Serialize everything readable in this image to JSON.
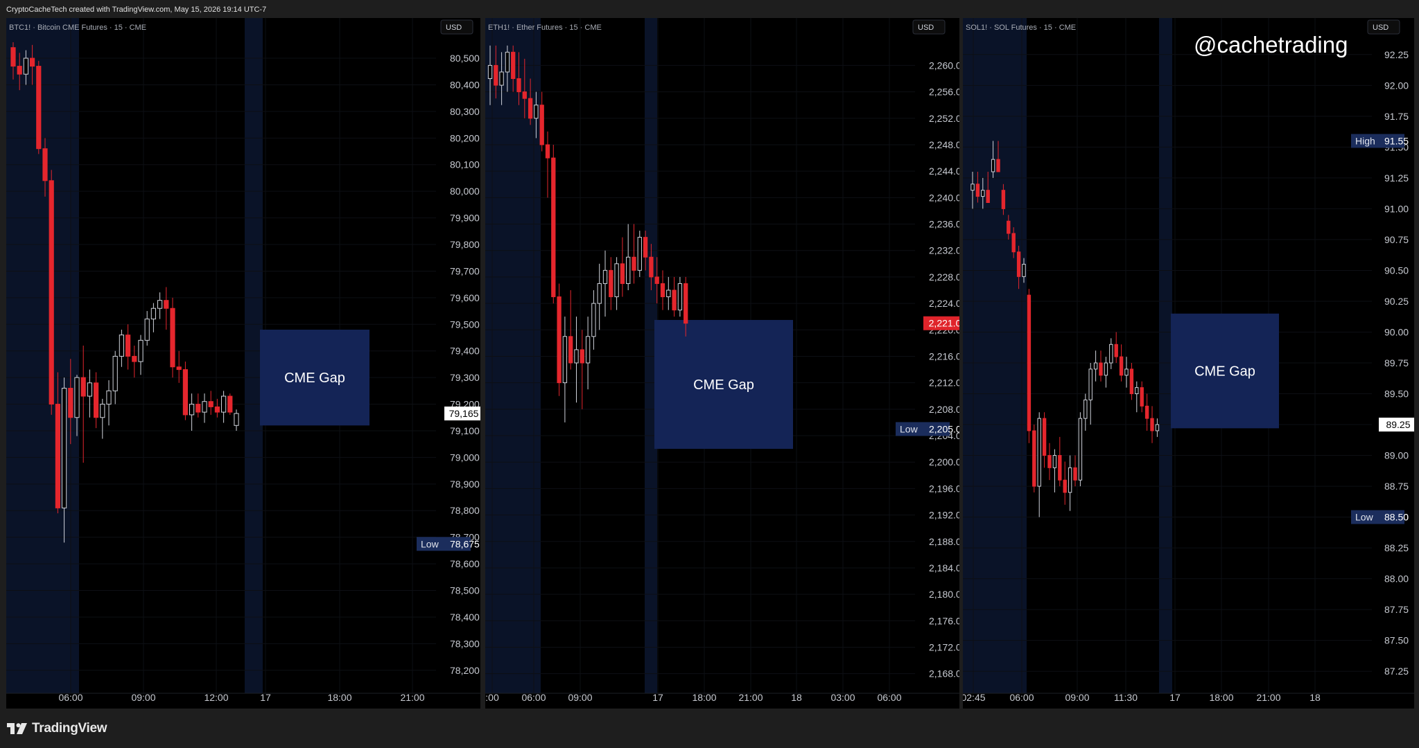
{
  "header": {
    "attribution": "CryptoCacheTech created with TradingView.com, May 15, 2026 19:14 UTC-7"
  },
  "watermark": "@cachetrading",
  "footer": {
    "brand": "TradingView"
  },
  "colors": {
    "up": "#d1d4dc",
    "down": "#e5262d",
    "gap_box": "#142456",
    "session_shade": "#0a1328",
    "label_bg": "#1b2d5c",
    "last_price_white": "#ffffff",
    "last_price_red": "#e0242b"
  },
  "chart_data": [
    {
      "type": "candlestick",
      "symbol_label": "BTC1! · Bitcoin CME Futures · 15 · CME",
      "currency": "USD",
      "ylim": [
        78150,
        80560
      ],
      "y_ticks": [
        78200,
        78300,
        78400,
        78500,
        78600,
        78700,
        78800,
        78900,
        79000,
        79100,
        79200,
        79300,
        79400,
        79500,
        79600,
        79700,
        79800,
        79900,
        80000,
        80100,
        80200,
        80300,
        80400,
        80500
      ],
      "y_tick_labels": [
        "78,200",
        "78,300",
        "78,400",
        "78,500",
        "78,600",
        "78,700",
        "78,800",
        "78,900",
        "79,000",
        "79,100",
        "79,200",
        "79,300",
        "79,400",
        "79,500",
        "79,600",
        "79,700",
        "79,800",
        "79,900",
        "80,000",
        "80,100",
        "80,200",
        "80,300",
        "80,400",
        "80,500"
      ],
      "x_ticks": [
        "06:00",
        "09:00",
        "12:00",
        "17",
        "18:00",
        "21:00"
      ],
      "last_price": {
        "value": 79165,
        "label": "79,165",
        "style": "white"
      },
      "low_marker": {
        "tag": "Low",
        "value": 78675,
        "label": "78,675"
      },
      "gap": {
        "label": "CME Gap",
        "from": 79120,
        "to": 79480
      },
      "candles": [
        {
          "o": 80540,
          "h": 80560,
          "l": 80420,
          "c": 80470
        },
        {
          "o": 80470,
          "h": 80520,
          "l": 80380,
          "c": 80440
        },
        {
          "o": 80440,
          "h": 80530,
          "l": 80400,
          "c": 80500
        },
        {
          "o": 80500,
          "h": 80550,
          "l": 80400,
          "c": 80470
        },
        {
          "o": 80470,
          "h": 80490,
          "l": 80140,
          "c": 80160
        },
        {
          "o": 80160,
          "h": 80200,
          "l": 79980,
          "c": 80040
        },
        {
          "o": 80040,
          "h": 80080,
          "l": 79160,
          "c": 79200
        },
        {
          "o": 79200,
          "h": 79320,
          "l": 78790,
          "c": 78810
        },
        {
          "o": 78810,
          "h": 79300,
          "l": 78680,
          "c": 79260
        },
        {
          "o": 79260,
          "h": 79370,
          "l": 79050,
          "c": 79150
        },
        {
          "o": 79150,
          "h": 79310,
          "l": 79080,
          "c": 79300
        },
        {
          "o": 79300,
          "h": 79420,
          "l": 78980,
          "c": 79230
        },
        {
          "o": 79230,
          "h": 79330,
          "l": 79150,
          "c": 79280
        },
        {
          "o": 79280,
          "h": 79320,
          "l": 79110,
          "c": 79150
        },
        {
          "o": 79150,
          "h": 79220,
          "l": 79070,
          "c": 79200
        },
        {
          "o": 79200,
          "h": 79290,
          "l": 79120,
          "c": 79250
        },
        {
          "o": 79250,
          "h": 79400,
          "l": 79200,
          "c": 79380
        },
        {
          "o": 79380,
          "h": 79480,
          "l": 79340,
          "c": 79460
        },
        {
          "o": 79460,
          "h": 79500,
          "l": 79330,
          "c": 79380
        },
        {
          "o": 79380,
          "h": 79420,
          "l": 79300,
          "c": 79360
        },
        {
          "o": 79360,
          "h": 79460,
          "l": 79310,
          "c": 79440
        },
        {
          "o": 79440,
          "h": 79550,
          "l": 79420,
          "c": 79520
        },
        {
          "o": 79520,
          "h": 79580,
          "l": 79470,
          "c": 79560
        },
        {
          "o": 79560,
          "h": 79620,
          "l": 79520,
          "c": 79590
        },
        {
          "o": 79590,
          "h": 79640,
          "l": 79480,
          "c": 79560
        },
        {
          "o": 79560,
          "h": 79600,
          "l": 79300,
          "c": 79340
        },
        {
          "o": 79340,
          "h": 79400,
          "l": 79280,
          "c": 79330
        },
        {
          "o": 79330,
          "h": 79360,
          "l": 79140,
          "c": 79160
        },
        {
          "o": 79160,
          "h": 79240,
          "l": 79100,
          "c": 79200
        },
        {
          "o": 79200,
          "h": 79240,
          "l": 79150,
          "c": 79170
        },
        {
          "o": 79170,
          "h": 79240,
          "l": 79130,
          "c": 79210
        },
        {
          "o": 79210,
          "h": 79250,
          "l": 79160,
          "c": 79190
        },
        {
          "o": 79190,
          "h": 79220,
          "l": 79150,
          "c": 79170
        },
        {
          "o": 79170,
          "h": 79250,
          "l": 79130,
          "c": 79230
        },
        {
          "o": 79230,
          "h": 79240,
          "l": 79160,
          "c": 79170
        },
        {
          "o": 79120,
          "h": 79180,
          "l": 79100,
          "c": 79165
        }
      ]
    },
    {
      "type": "candlestick",
      "symbol_label": "ETH1! · Ether Futures · 15 · CME",
      "currency": "USD",
      "ylim": [
        2166.5,
        2263.5
      ],
      "y_ticks": [
        2168,
        2172,
        2176,
        2180,
        2184,
        2188,
        2192,
        2196,
        2200,
        2204,
        2208,
        2212,
        2216,
        2220,
        2224,
        2228,
        2232,
        2236,
        2240,
        2244,
        2248,
        2252,
        2256,
        2260
      ],
      "y_tick_labels": [
        "2,168.0",
        "2,172.0",
        "2,176.0",
        "2,180.0",
        "2,184.0",
        "2,188.0",
        "2,192.0",
        "2,196.0",
        "2,200.0",
        "2,204.0",
        "2,208.0",
        "2,212.0",
        "2,216.0",
        "2,220.0",
        "2,224.0",
        "2,228.0",
        "2,232.0",
        "2,236.0",
        "2,240.0",
        "2,244.0",
        "2,248.0",
        "2,252.0",
        "2,256.0",
        "2,260.0"
      ],
      "x_ticks": [
        ":00",
        "06:00",
        "09:00",
        "17",
        "18:00",
        "21:00",
        "18",
        "03:00",
        "06:00"
      ],
      "last_price": {
        "value": 2221,
        "label": "2,221.0",
        "style": "red"
      },
      "low_marker": {
        "tag": "Low",
        "value": 2205,
        "label": "2,205.0"
      },
      "gap": {
        "label": "CME Gap",
        "from": 2202,
        "to": 2221.5
      },
      "candles": [
        {
          "o": 2258,
          "h": 2263,
          "l": 2254,
          "c": 2260
        },
        {
          "o": 2260,
          "h": 2263,
          "l": 2255,
          "c": 2257
        },
        {
          "o": 2257,
          "h": 2262,
          "l": 2254,
          "c": 2259
        },
        {
          "o": 2259,
          "h": 2263,
          "l": 2256,
          "c": 2262
        },
        {
          "o": 2262,
          "h": 2263,
          "l": 2256,
          "c": 2258
        },
        {
          "o": 2258,
          "h": 2262,
          "l": 2254,
          "c": 2256
        },
        {
          "o": 2256,
          "h": 2261,
          "l": 2252,
          "c": 2255
        },
        {
          "o": 2255,
          "h": 2258,
          "l": 2251,
          "c": 2252
        },
        {
          "o": 2252,
          "h": 2256,
          "l": 2249,
          "c": 2254
        },
        {
          "o": 2254,
          "h": 2256,
          "l": 2247,
          "c": 2248
        },
        {
          "o": 2248,
          "h": 2250,
          "l": 2240,
          "c": 2246
        },
        {
          "o": 2246,
          "h": 2248,
          "l": 2224,
          "c": 2225
        },
        {
          "o": 2225,
          "h": 2227,
          "l": 2210,
          "c": 2212
        },
        {
          "o": 2212,
          "h": 2222,
          "l": 2206,
          "c": 2219
        },
        {
          "o": 2219,
          "h": 2226,
          "l": 2214,
          "c": 2215
        },
        {
          "o": 2215,
          "h": 2222,
          "l": 2209,
          "c": 2217
        },
        {
          "o": 2217,
          "h": 2220,
          "l": 2208,
          "c": 2215
        },
        {
          "o": 2215,
          "h": 2222,
          "l": 2211,
          "c": 2219
        },
        {
          "o": 2219,
          "h": 2226,
          "l": 2217,
          "c": 2224
        },
        {
          "o": 2224,
          "h": 2230,
          "l": 2220,
          "c": 2227
        },
        {
          "o": 2227,
          "h": 2232,
          "l": 2222,
          "c": 2229
        },
        {
          "o": 2229,
          "h": 2231,
          "l": 2223,
          "c": 2225
        },
        {
          "o": 2225,
          "h": 2231,
          "l": 2223,
          "c": 2230
        },
        {
          "o": 2230,
          "h": 2234,
          "l": 2225,
          "c": 2227
        },
        {
          "o": 2227,
          "h": 2236,
          "l": 2226,
          "c": 2231
        },
        {
          "o": 2231,
          "h": 2236,
          "l": 2227,
          "c": 2229
        },
        {
          "o": 2229,
          "h": 2235,
          "l": 2228,
          "c": 2234
        },
        {
          "o": 2234,
          "h": 2235,
          "l": 2229,
          "c": 2231
        },
        {
          "o": 2231,
          "h": 2233,
          "l": 2226,
          "c": 2228
        },
        {
          "o": 2228,
          "h": 2231,
          "l": 2224,
          "c": 2227
        },
        {
          "o": 2227,
          "h": 2229,
          "l": 2223,
          "c": 2225
        },
        {
          "o": 2225,
          "h": 2228,
          "l": 2223,
          "c": 2226
        },
        {
          "o": 2226,
          "h": 2228,
          "l": 2222,
          "c": 2223
        },
        {
          "o": 2223,
          "h": 2228,
          "l": 2222,
          "c": 2227
        },
        {
          "o": 2227,
          "h": 2228,
          "l": 2219,
          "c": 2221
        }
      ]
    },
    {
      "type": "candlestick",
      "symbol_label": "SOL1! · SOL Futures · 15 · CME",
      "currency": "USD",
      "ylim": [
        87.15,
        92.35
      ],
      "y_ticks": [
        87.25,
        87.5,
        87.75,
        88,
        88.25,
        88.5,
        88.75,
        89,
        89.25,
        89.5,
        89.75,
        90,
        90.25,
        90.5,
        90.75,
        91,
        91.25,
        91.5,
        91.75,
        92,
        92.25
      ],
      "y_tick_labels": [
        "87.25",
        "87.50",
        "87.75",
        "88.00",
        "88.25",
        "88.50",
        "88.75",
        "89.00",
        "89.25",
        "89.50",
        "89.75",
        "90.00",
        "90.25",
        "90.50",
        "90.75",
        "91.00",
        "91.25",
        "91.50",
        "91.75",
        "92.00",
        "92.25"
      ],
      "x_ticks": [
        "02:45",
        "06:00",
        "09:00",
        "11:30",
        "17",
        "18:00",
        "21:00",
        "18"
      ],
      "last_price": {
        "value": 89.25,
        "label": "89.25",
        "style": "white"
      },
      "high_marker": {
        "tag": "High",
        "value": 91.55,
        "label": "91.55"
      },
      "low_marker": {
        "tag": "Low",
        "value": 88.5,
        "label": "88.50"
      },
      "gap": {
        "label": "CME Gap",
        "from": 89.22,
        "to": 90.15
      },
      "candles": [
        {
          "o": 91.15,
          "h": 91.3,
          "l": 91.0,
          "c": 91.2
        },
        {
          "o": 91.2,
          "h": 91.3,
          "l": 91.05,
          "c": 91.1
        },
        {
          "o": 91.1,
          "h": 91.25,
          "l": 91.0,
          "c": 91.15
        },
        {
          "o": 91.15,
          "h": 91.3,
          "l": 91.05,
          "c": 91.05
        },
        {
          "o": 91.3,
          "h": 91.55,
          "l": 91.25,
          "c": 91.4
        },
        {
          "o": 91.4,
          "h": 91.55,
          "l": 91.3,
          "c": 91.3
        },
        {
          "o": 91.15,
          "h": 91.2,
          "l": 90.95,
          "c": 91.0
        },
        {
          "o": 90.9,
          "h": 90.95,
          "l": 90.75,
          "c": 90.8
        },
        {
          "o": 90.8,
          "h": 90.85,
          "l": 90.6,
          "c": 90.65
        },
        {
          "o": 90.65,
          "h": 90.7,
          "l": 90.35,
          "c": 90.45
        },
        {
          "o": 90.45,
          "h": 90.6,
          "l": 90.4,
          "c": 90.55
        },
        {
          "o": 90.3,
          "h": 90.35,
          "l": 89.1,
          "c": 89.2
        },
        {
          "o": 89.2,
          "h": 89.25,
          "l": 88.7,
          "c": 88.75
        },
        {
          "o": 88.75,
          "h": 89.35,
          "l": 88.5,
          "c": 89.3
        },
        {
          "o": 89.3,
          "h": 89.35,
          "l": 88.9,
          "c": 89.0
        },
        {
          "o": 89.0,
          "h": 89.1,
          "l": 88.8,
          "c": 88.9
        },
        {
          "o": 88.9,
          "h": 89.05,
          "l": 88.7,
          "c": 89.0
        },
        {
          "o": 89.0,
          "h": 89.15,
          "l": 88.75,
          "c": 88.8
        },
        {
          "o": 88.8,
          "h": 88.95,
          "l": 88.6,
          "c": 88.7
        },
        {
          "o": 88.7,
          "h": 89.0,
          "l": 88.55,
          "c": 88.9
        },
        {
          "o": 88.9,
          "h": 89.0,
          "l": 88.75,
          "c": 88.8
        },
        {
          "o": 88.8,
          "h": 89.35,
          "l": 88.75,
          "c": 89.3
        },
        {
          "o": 89.3,
          "h": 89.5,
          "l": 89.2,
          "c": 89.45
        },
        {
          "o": 89.45,
          "h": 89.75,
          "l": 89.25,
          "c": 89.7
        },
        {
          "o": 89.7,
          "h": 89.85,
          "l": 89.6,
          "c": 89.75
        },
        {
          "o": 89.75,
          "h": 89.85,
          "l": 89.6,
          "c": 89.65
        },
        {
          "o": 89.65,
          "h": 89.8,
          "l": 89.55,
          "c": 89.75
        },
        {
          "o": 89.75,
          "h": 89.95,
          "l": 89.7,
          "c": 89.9
        },
        {
          "o": 89.9,
          "h": 90.0,
          "l": 89.75,
          "c": 89.8
        },
        {
          "o": 89.8,
          "h": 89.9,
          "l": 89.6,
          "c": 89.65
        },
        {
          "o": 89.65,
          "h": 89.8,
          "l": 89.55,
          "c": 89.7
        },
        {
          "o": 89.7,
          "h": 89.75,
          "l": 89.45,
          "c": 89.5
        },
        {
          "o": 89.5,
          "h": 89.6,
          "l": 89.35,
          "c": 89.55
        },
        {
          "o": 89.55,
          "h": 89.6,
          "l": 89.35,
          "c": 89.4
        },
        {
          "o": 89.4,
          "h": 89.5,
          "l": 89.2,
          "c": 89.3
        },
        {
          "o": 89.3,
          "h": 89.4,
          "l": 89.1,
          "c": 89.2
        },
        {
          "o": 89.2,
          "h": 89.3,
          "l": 89.15,
          "c": 89.25
        }
      ]
    }
  ]
}
